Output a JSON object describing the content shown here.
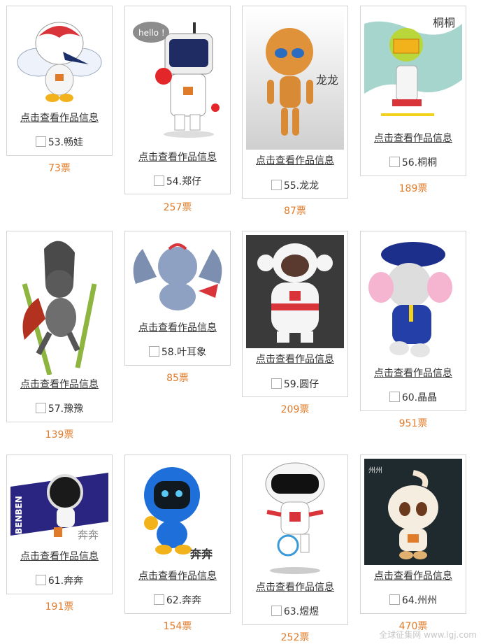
{
  "items": [
    {
      "id": "53",
      "name": "53.畅娃",
      "link": "点击查看作品信息",
      "votes": "73票",
      "icon": "mascot-bird-icon"
    },
    {
      "id": "54",
      "name": "54.郑仔",
      "link": "点击查看作品信息",
      "votes": "257票",
      "icon": "mascot-robot-hello-icon",
      "badge": "hello !"
    },
    {
      "id": "55",
      "name": "55.龙龙",
      "link": "点击查看作品信息",
      "votes": "87票",
      "icon": "mascot-dragon-icon",
      "caption": "龙龙"
    },
    {
      "id": "56",
      "name": "56.桐桐",
      "link": "点击查看作品信息",
      "votes": "189票",
      "icon": "mascot-girl-icon",
      "caption": "桐桐"
    },
    {
      "id": "57",
      "name": "57.豫豫",
      "link": "点击查看作品信息",
      "votes": "139票",
      "icon": "mascot-skier-icon"
    },
    {
      "id": "58",
      "name": "58.叶耳象",
      "link": "点击查看作品信息",
      "votes": "85票",
      "icon": "mascot-elephant-icon"
    },
    {
      "id": "59",
      "name": "59.圆仔",
      "link": "点击查看作品信息",
      "votes": "209票",
      "icon": "mascot-monkey-icon"
    },
    {
      "id": "60",
      "name": "60.晶晶",
      "link": "点击查看作品信息",
      "votes": "951票",
      "icon": "mascot-conductor-elephant-icon"
    },
    {
      "id": "61",
      "name": "61.奔奔",
      "link": "点击查看作品信息",
      "votes": "191票",
      "icon": "mascot-benben-icon",
      "banner": "BENBEN",
      "caption": "奔奔"
    },
    {
      "id": "62",
      "name": "62.奔奔",
      "link": "点击查看作品信息",
      "votes": "154票",
      "icon": "mascot-blue-robot-icon",
      "caption": "奔奔"
    },
    {
      "id": "63",
      "name": "63.煜煜",
      "link": "点击查看作品信息",
      "votes": "252票",
      "icon": "mascot-train-robot-icon"
    },
    {
      "id": "64",
      "name": "64.州州",
      "link": "点击查看作品信息",
      "votes": "470票",
      "icon": "mascot-baby-icon",
      "caption": "州州"
    }
  ],
  "watermark": "全球征集网 www.lgj.com"
}
